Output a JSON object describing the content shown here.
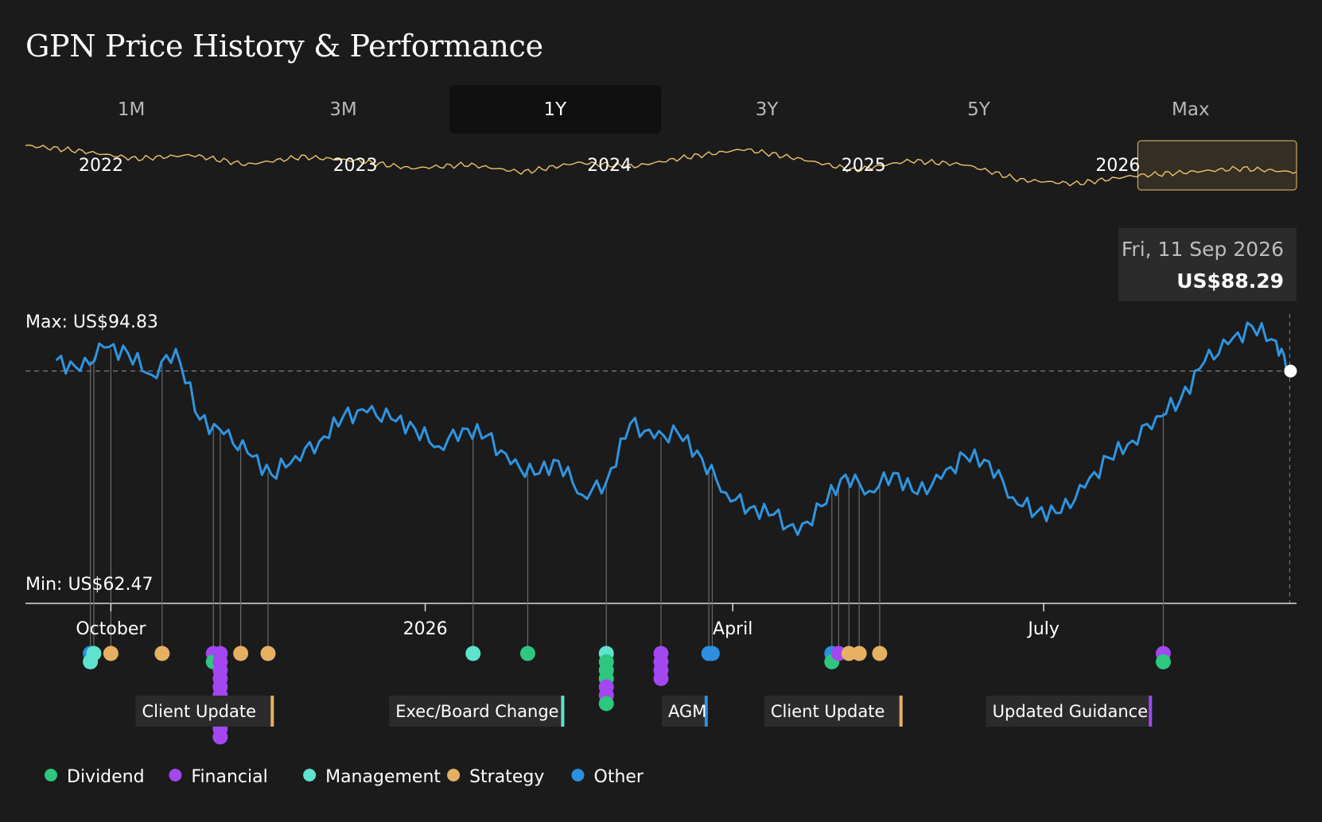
{
  "header": {
    "title": "GPN Price History & Performance"
  },
  "range_tabs": [
    "1M",
    "3M",
    "1Y",
    "3Y",
    "5Y",
    "Max"
  ],
  "active_tab": "1Y",
  "colors": {
    "background": "#1b1b1b",
    "price_line": "#2f95e0",
    "overview_line": "#f0c26a",
    "dividend": "#2dc77e",
    "financial": "#a347f0",
    "management": "#5fe3cf",
    "strategy": "#e6b062",
    "other": "#2c8fe0"
  },
  "chart_data": {
    "type": "line",
    "title": "GPN Price History & Performance",
    "series": [
      {
        "name": "",
        "x": [
          "2025-09-15",
          "2025-09-22",
          "2025-09-29",
          "2025-10-06",
          "2025-10-13",
          "2025-10-20",
          "2025-10-27",
          "2025-11-03",
          "2025-11-10",
          "2025-11-17",
          "2025-11-24",
          "2025-12-01",
          "2025-12-08",
          "2025-12-15",
          "2025-12-22",
          "2025-12-29",
          "2026-01-05",
          "2026-01-12",
          "2026-01-19",
          "2026-01-26",
          "2026-02-02",
          "2026-02-09",
          "2026-02-16",
          "2026-02-23",
          "2026-03-02",
          "2026-03-09",
          "2026-03-16",
          "2026-03-23",
          "2026-03-30",
          "2026-04-06",
          "2026-04-13",
          "2026-04-20",
          "2026-04-27",
          "2026-05-04",
          "2026-05-11",
          "2026-05-18",
          "2026-05-25",
          "2026-06-01",
          "2026-06-08",
          "2026-06-15",
          "2026-06-22",
          "2026-06-29",
          "2026-07-06",
          "2026-07-13",
          "2026-07-20",
          "2026-07-27",
          "2026-08-03",
          "2026-08-10",
          "2026-08-17",
          "2026-08-24",
          "2026-08-31",
          "2026-09-07",
          "2026-09-11"
        ],
        "values": [
          89.6,
          88.3,
          91.2,
          90.5,
          87.8,
          91.0,
          82.3,
          80.5,
          78.2,
          75.5,
          77.8,
          79.6,
          82.7,
          83.2,
          82.4,
          81.2,
          79.0,
          81.2,
          80.3,
          76.8,
          75.5,
          77.2,
          73.0,
          74.6,
          81.8,
          80.0,
          80.6,
          77.5,
          73.3,
          71.4,
          70.6,
          68.1,
          71.6,
          75.5,
          73.5,
          75.7,
          73.1,
          75.0,
          77.8,
          77.1,
          72.7,
          70.9,
          70.8,
          73.9,
          77.6,
          79.7,
          82.7,
          84.7,
          89.4,
          91.6,
          93.8,
          92.0,
          88.3
        ]
      }
    ],
    "y_max_label": "Max: US$94.83",
    "y_min_label": "Min: US$62.47",
    "ylim": [
      62.47,
      94.83
    ],
    "reference_line": 88.29,
    "x_ticks": [
      "October",
      "2026",
      "April",
      "July"
    ],
    "tooltip": {
      "date": "Fri, 11 Sep 2026",
      "value": "US$88.29"
    },
    "overview": {
      "years": [
        "2022",
        "2023",
        "2024",
        "2025",
        "2026"
      ],
      "selected": "2026",
      "values": [
        92,
        89,
        85,
        87,
        82,
        86,
        84,
        80,
        82,
        78,
        83,
        81,
        86,
        90,
        85,
        79,
        84,
        82,
        74,
        72,
        76,
        78,
        80,
        78
      ]
    },
    "event_labels": [
      {
        "text": "Client Update",
        "category": "strategy",
        "date": "2025-11-17"
      },
      {
        "text": "Exec/Board Change",
        "category": "management",
        "date": "2026-02-10"
      },
      {
        "text": "AGM",
        "category": "other",
        "date": "2026-03-24"
      },
      {
        "text": "Client Update",
        "category": "strategy",
        "date": "2026-05-20"
      },
      {
        "text": "Updated Guidance",
        "category": "financial",
        "date": "2026-08-01"
      }
    ],
    "event_markers": [
      {
        "date": "2025-09-25",
        "categories": [
          "other",
          "management"
        ]
      },
      {
        "date": "2025-09-26",
        "categories": [
          "management"
        ]
      },
      {
        "date": "2025-10-01",
        "categories": [
          "strategy"
        ]
      },
      {
        "date": "2025-10-16",
        "categories": [
          "strategy"
        ]
      },
      {
        "date": "2025-10-31",
        "categories": [
          "financial",
          "dividend"
        ]
      },
      {
        "date": "2025-11-02",
        "categories": [
          "financial",
          "financial",
          "financial",
          "financial",
          "financial",
          "financial",
          "financial",
          "financial",
          "financial",
          "financial",
          "financial"
        ]
      },
      {
        "date": "2025-11-08",
        "categories": [
          "strategy"
        ]
      },
      {
        "date": "2025-11-16",
        "categories": [
          "strategy"
        ]
      },
      {
        "date": "2026-01-15",
        "categories": [
          "management"
        ]
      },
      {
        "date": "2026-01-31",
        "categories": [
          "dividend"
        ]
      },
      {
        "date": "2026-02-23",
        "categories": [
          "management",
          "dividend",
          "dividend",
          "dividend",
          "financial",
          "financial",
          "dividend"
        ]
      },
      {
        "date": "2026-03-11",
        "categories": [
          "financial",
          "financial",
          "financial",
          "financial"
        ]
      },
      {
        "date": "2026-03-25",
        "categories": [
          "other"
        ]
      },
      {
        "date": "2026-03-26",
        "categories": [
          "other"
        ]
      },
      {
        "date": "2026-04-30",
        "categories": [
          "other",
          "dividend"
        ]
      },
      {
        "date": "2026-05-02",
        "categories": [
          "financial"
        ]
      },
      {
        "date": "2026-05-05",
        "categories": [
          "strategy"
        ]
      },
      {
        "date": "2026-05-08",
        "categories": [
          "strategy"
        ]
      },
      {
        "date": "2026-05-14",
        "categories": [
          "strategy"
        ]
      },
      {
        "date": "2026-08-05",
        "categories": [
          "financial",
          "dividend"
        ]
      }
    ],
    "legend": {
      "placement": "bottom-left",
      "items": [
        {
          "label": "Dividend",
          "category": "dividend"
        },
        {
          "label": "Financial",
          "category": "financial"
        },
        {
          "label": "Management",
          "category": "management"
        },
        {
          "label": "Strategy",
          "category": "strategy"
        },
        {
          "label": "Other",
          "category": "other"
        }
      ]
    }
  }
}
